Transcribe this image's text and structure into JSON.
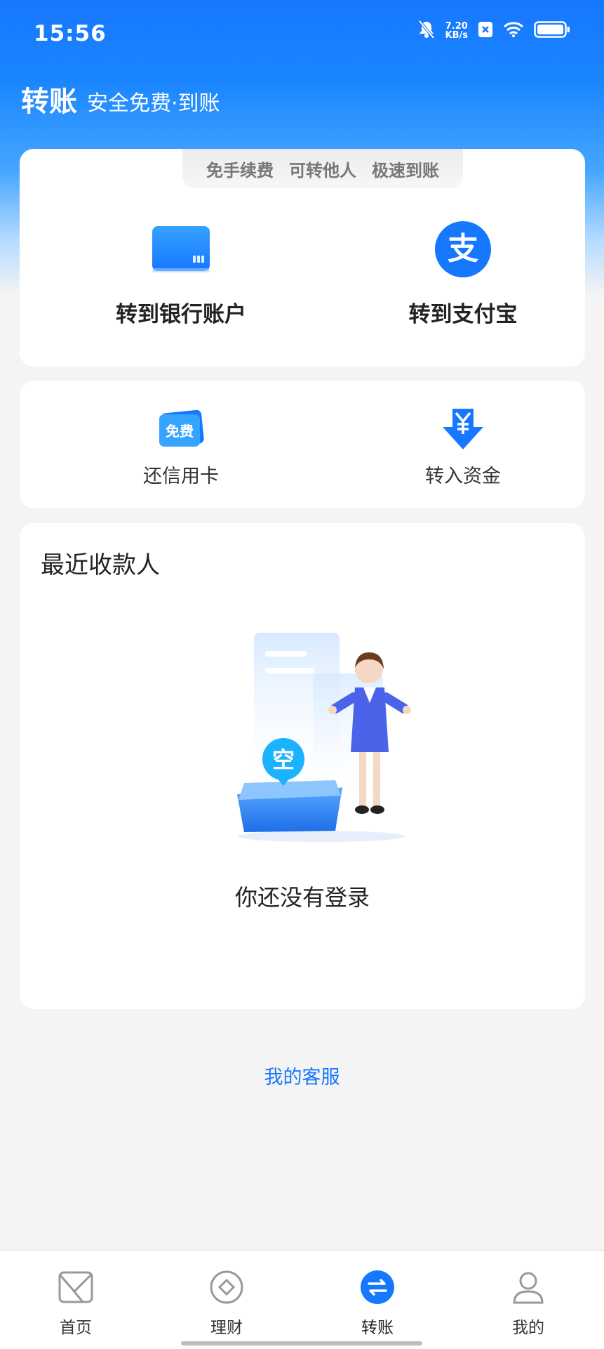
{
  "status_bar": {
    "time": "15:56",
    "net_speed_value": "7.20",
    "net_speed_unit": "KB/s",
    "icons": [
      "mute-bell-icon",
      "close-badge-icon",
      "wifi-icon",
      "battery-icon"
    ]
  },
  "header": {
    "title": "转账",
    "subtitle": "安全免费·到账"
  },
  "features": [
    "免手续费",
    "可转他人",
    "极速到账"
  ],
  "transfer_options": [
    {
      "label": "转到银行账户",
      "icon": "bank-card-icon"
    },
    {
      "label": "转到支付宝",
      "icon": "alipay-icon"
    }
  ],
  "quick_actions": [
    {
      "label": "还信用卡",
      "icon": "free-card-icon",
      "badge": "免费"
    },
    {
      "label": "转入资金",
      "icon": "yuan-down-icon"
    }
  ],
  "recent": {
    "title": "最近收款人",
    "empty_badge": "空",
    "empty_text": "你还没有登录"
  },
  "service_link": "我的客服",
  "nav": [
    {
      "label": "首页",
      "icon": "home-icon",
      "active": false
    },
    {
      "label": "理财",
      "icon": "finance-icon",
      "active": false
    },
    {
      "label": "转账",
      "icon": "transfer-icon",
      "active": true
    },
    {
      "label": "我的",
      "icon": "profile-icon",
      "active": false
    }
  ],
  "colors": {
    "brand_blue": "#1677ff",
    "page_bg": "#f4f4f4",
    "card_bg": "#ffffff"
  }
}
